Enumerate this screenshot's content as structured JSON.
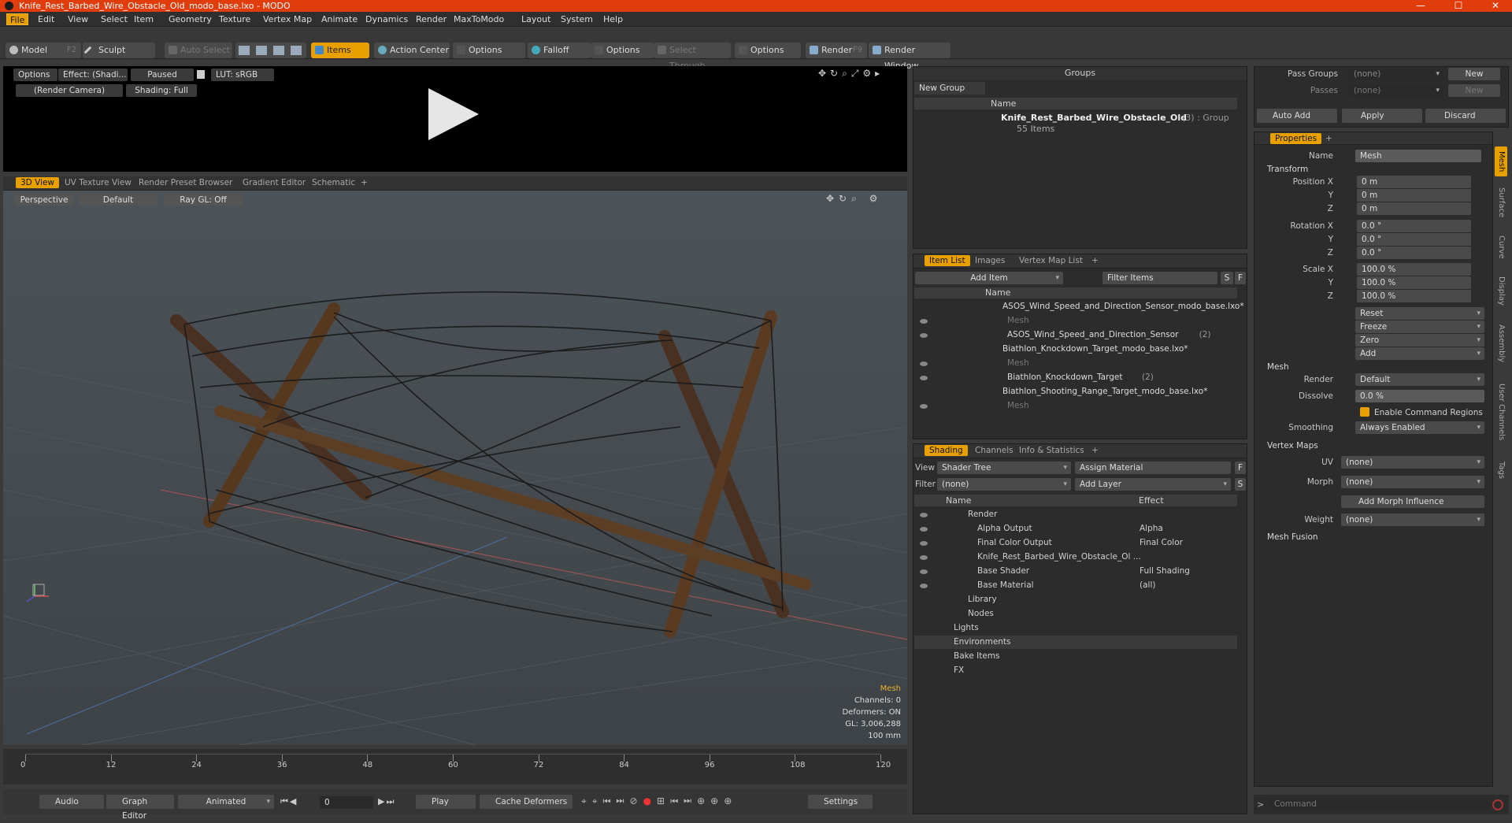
{
  "window": {
    "title": "Knife_Rest_Barbed_Wire_Obstacle_Old_modo_base.lxo - MODO",
    "minimize": "—",
    "maximize": "☐",
    "close": "✕"
  },
  "menus": [
    "File",
    "Edit",
    "View",
    "Select",
    "Item",
    "Geometry",
    "Texture",
    "Vertex Map",
    "Animate",
    "Dynamics",
    "Render",
    "MaxToModo",
    "Layout",
    "System",
    "Help"
  ],
  "toolbar": {
    "model": "Model",
    "model_key": "F2",
    "sculpt": "Sculpt",
    "auto_select": "Auto Select",
    "items": "Items",
    "action_center": "Action Center",
    "options1": "Options",
    "falloff": "Falloff",
    "options2": "Options",
    "select_through": "Select Through",
    "options3": "Options",
    "render": "Render",
    "render_key": "F9",
    "render_window": "Render Window"
  },
  "preview": {
    "options": "Options",
    "effect": "Effect: (Shadi...",
    "paused": "Paused",
    "lut": "LUT: sRGB",
    "camera": "(Render Camera)",
    "shading": "Shading: Full"
  },
  "viewport_tabs": [
    "3D View",
    "UV Texture View",
    "Render Preset Browser",
    "Gradient Editor",
    "Schematic",
    "+"
  ],
  "viewport": {
    "perspective": "Perspective",
    "default": "Default",
    "raygl": "Ray GL: Off",
    "info": {
      "type": "Mesh",
      "channels": "Channels: 0",
      "deformers": "Deformers: ON",
      "gl": "GL: 3,006,288",
      "scale": "100 mm"
    }
  },
  "timeline": {
    "ticks": [
      "0",
      "12",
      "24",
      "36",
      "48",
      "60",
      "72",
      "84",
      "96",
      "108",
      "120"
    ],
    "sub_ticks": [
      "0",
      "120",
      "120"
    ]
  },
  "transport": {
    "audio": "Audio",
    "graph_editor": "Graph Editor",
    "animated": "Animated",
    "frame": "0",
    "play": "Play",
    "cache_deformers": "Cache Deformers",
    "settings": "Settings"
  },
  "groups": {
    "title": "Groups",
    "new_group": "New Group",
    "col_name": "Name",
    "item_name": "Knife_Rest_Barbed_Wire_Obstacle_Old",
    "item_suffix": "(3) : Group",
    "item_count": "55 Items"
  },
  "itemlist": {
    "tabs": [
      "Item List",
      "Images",
      "Vertex Map List",
      "+"
    ],
    "add_item": "Add Item",
    "filter": "Filter Items",
    "s": "S",
    "f": "F",
    "col_name": "Name",
    "rows": [
      {
        "text": "ASOS_Wind_Speed_and_Direction_Sensor_modo_base.lxo*",
        "indent": 0,
        "dim": false
      },
      {
        "text": "Mesh",
        "indent": 1,
        "dim": true
      },
      {
        "text": "ASOS_Wind_Speed_and_Direction_Sensor",
        "suffix": "(2)",
        "indent": 1,
        "dim": false
      },
      {
        "text": "Biathlon_Knockdown_Target_modo_base.lxo*",
        "indent": 0,
        "dim": false
      },
      {
        "text": "Mesh",
        "indent": 1,
        "dim": true
      },
      {
        "text": "Biathlon_Knockdown_Target",
        "suffix": "(2)",
        "indent": 1,
        "dim": false
      },
      {
        "text": "Biathlon_Shooting_Range_Target_modo_base.lxo*",
        "indent": 0,
        "dim": false
      },
      {
        "text": "Mesh",
        "indent": 1,
        "dim": true
      }
    ]
  },
  "shading": {
    "tabs": [
      "Shading",
      "Channels",
      "Info & Statistics",
      "+"
    ],
    "view_label": "View",
    "view_value": "Shader Tree",
    "assign_material": "Assign Material",
    "f": "F",
    "filter_label": "Filter",
    "filter_value": "(none)",
    "add_layer": "Add Layer",
    "s": "S",
    "col_name": "Name",
    "col_effect": "Effect",
    "rows": [
      {
        "name": "Render",
        "effect": "",
        "indent": 0
      },
      {
        "name": "Alpha Output",
        "effect": "Alpha",
        "indent": 1
      },
      {
        "name": "Final Color Output",
        "effect": "Final Color",
        "indent": 1
      },
      {
        "name": "Knife_Rest_Barbed_Wire_Obstacle_Ol ...",
        "effect": "",
        "indent": 1
      },
      {
        "name": "Base Shader",
        "effect": "Full Shading",
        "indent": 1
      },
      {
        "name": "Base Material",
        "effect": "(all)",
        "indent": 1
      },
      {
        "name": "Library",
        "effect": "",
        "indent": 0
      },
      {
        "name": "Nodes",
        "effect": "",
        "indent": 0
      },
      {
        "name": "Lights",
        "effect": "",
        "indent": -1
      },
      {
        "name": "Environments",
        "effect": "",
        "indent": -1
      },
      {
        "name": "Bake Items",
        "effect": "",
        "indent": -1
      },
      {
        "name": "FX",
        "effect": "",
        "indent": -1
      }
    ]
  },
  "passes": {
    "pass_groups": "Pass Groups",
    "passes": "Passes",
    "none": "(none)",
    "new": "New",
    "auto_add": "Auto Add",
    "apply": "Apply",
    "discard": "Discard"
  },
  "properties": {
    "tab": "Properties",
    "plus": "+",
    "name_label": "Name",
    "name_value": "Mesh",
    "transform": "Transform",
    "position_x": "Position X",
    "y": "Y",
    "z": "Z",
    "pos": [
      "0 m",
      "0 m",
      "0 m"
    ],
    "rotation_x": "Rotation X",
    "rot": [
      "0.0 °",
      "0.0 °",
      "0.0 °"
    ],
    "scale_x": "Scale X",
    "scl": [
      "100.0 %",
      "100.0 %",
      "100.0 %"
    ],
    "reset": "Reset",
    "freeze": "Freeze",
    "zero": "Zero",
    "add": "Add",
    "mesh": "Mesh",
    "render_label": "Render",
    "render_value": "Default",
    "dissolve_label": "Dissolve",
    "dissolve_value": "0.0 %",
    "enable_cmd": "Enable Command Regions",
    "smoothing_label": "Smoothing",
    "smoothing_value": "Always Enabled",
    "vertex_maps": "Vertex Maps",
    "uv_label": "UV",
    "uv_value": "(none)",
    "morph_label": "Morph",
    "morph_value": "(none)",
    "add_morph": "Add Morph Influence",
    "weight_label": "Weight",
    "weight_value": "(none)",
    "mesh_fusion": "Mesh Fusion",
    "side_tabs": [
      "Mesh",
      "Surface",
      "Curve",
      "Display",
      "Assembly",
      "User Channels",
      "Tags"
    ]
  },
  "command": {
    "placeholder": "Command"
  },
  "colors": {
    "accent": "#e7a000",
    "title": "#e03c0c"
  }
}
